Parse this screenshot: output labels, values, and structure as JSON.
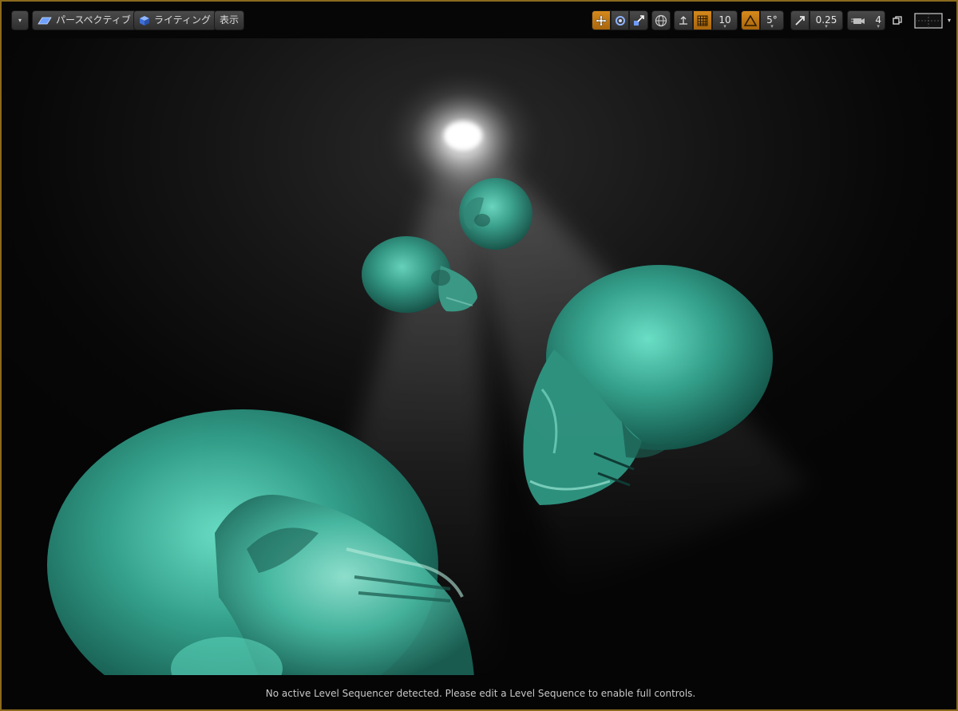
{
  "toolbar": {
    "menu_caret": "▾",
    "perspective_label": "パースペクティブ",
    "lighting_label": "ライティング",
    "show_label": "表示",
    "grid_snap_value": "10",
    "rotation_snap_value": "5°",
    "scale_snap_value": "0.25",
    "camera_speed_value": "4"
  },
  "colors": {
    "frame_border": "#8a6a1e",
    "active_button": "#c97a14",
    "skull_tint": "#3fc2a8"
  },
  "statusbar": {
    "message": "No active Level Sequencer detected. Please edit a Level Sequence to enable full controls."
  }
}
